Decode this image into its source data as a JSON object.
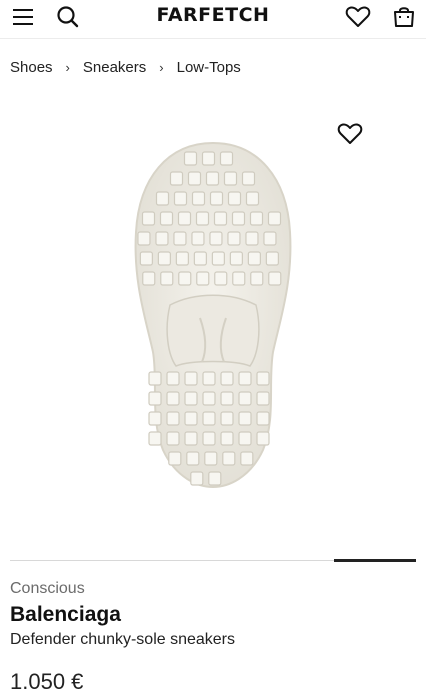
{
  "header": {
    "logo": "FARFETCH",
    "icons": [
      "menu-icon",
      "search-icon",
      "heart-icon",
      "shopping-bag-icon"
    ]
  },
  "breadcrumb": {
    "items": [
      "Shoes",
      "Sneakers",
      "Low-Tops"
    ],
    "separator": "›"
  },
  "gallery": {
    "slide_index": 5,
    "slide_count": 5
  },
  "product": {
    "tag": "Conscious",
    "brand": "Balenciaga",
    "name": "Defender chunky-sole sneakers",
    "price": "1.050 €"
  },
  "colors": {
    "text": "#222222",
    "muted": "#6b6b6b",
    "sole": "#efede6"
  }
}
